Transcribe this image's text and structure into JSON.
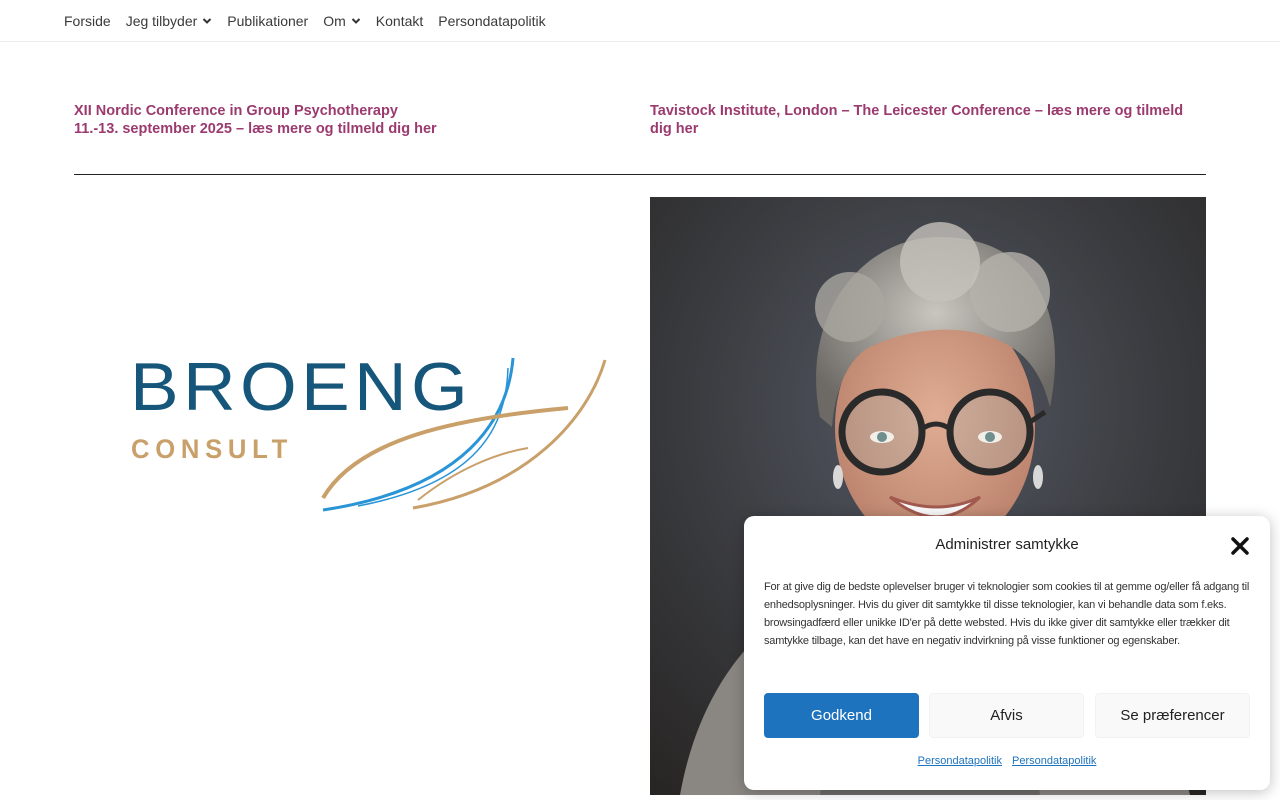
{
  "nav": {
    "items": [
      {
        "label": "Forside",
        "has_dropdown": false
      },
      {
        "label": "Jeg tilbyder",
        "has_dropdown": true
      },
      {
        "label": "Publikationer",
        "has_dropdown": false
      },
      {
        "label": "Om",
        "has_dropdown": true
      },
      {
        "label": "Kontakt",
        "has_dropdown": false
      },
      {
        "label": "Persondatapolitik",
        "has_dropdown": false
      }
    ]
  },
  "conferences": {
    "left_line1": "XII Nordic Conference in Group Psychotherapy",
    "left_line2": "11.-13. september 2025 – læs mere og tilmeld dig her",
    "right": "Tavistock Institute, London – The Leicester Conference – læs mere og tilmeld dig her"
  },
  "logo": {
    "word1": "BROENG",
    "word2": "CONSULT"
  },
  "consent": {
    "title": "Administrer samtykke",
    "body": "For at give dig de bedste oplevelser bruger vi teknologier som cookies til at gemme og/eller få adgang til enhedsoplysninger. Hvis du giver dit samtykke til disse teknologier, kan vi behandle data som f.eks. browsingadfærd eller unikke ID'er på dette websted. Hvis du ikke giver dit samtykke eller trækker dit samtykke tilbage, kan det have en negativ indvirkning på visse funktioner og egenskaber.",
    "accept_label": "Godkend",
    "deny_label": "Afvis",
    "prefs_label": "Se præferencer",
    "link1": "Persondatapolitik",
    "link2": "Persondatapolitik"
  },
  "colors": {
    "link": "#9b3a6e",
    "accent": "#1e73be",
    "logo_blue": "#15567a",
    "logo_gold": "#c9a06a"
  }
}
